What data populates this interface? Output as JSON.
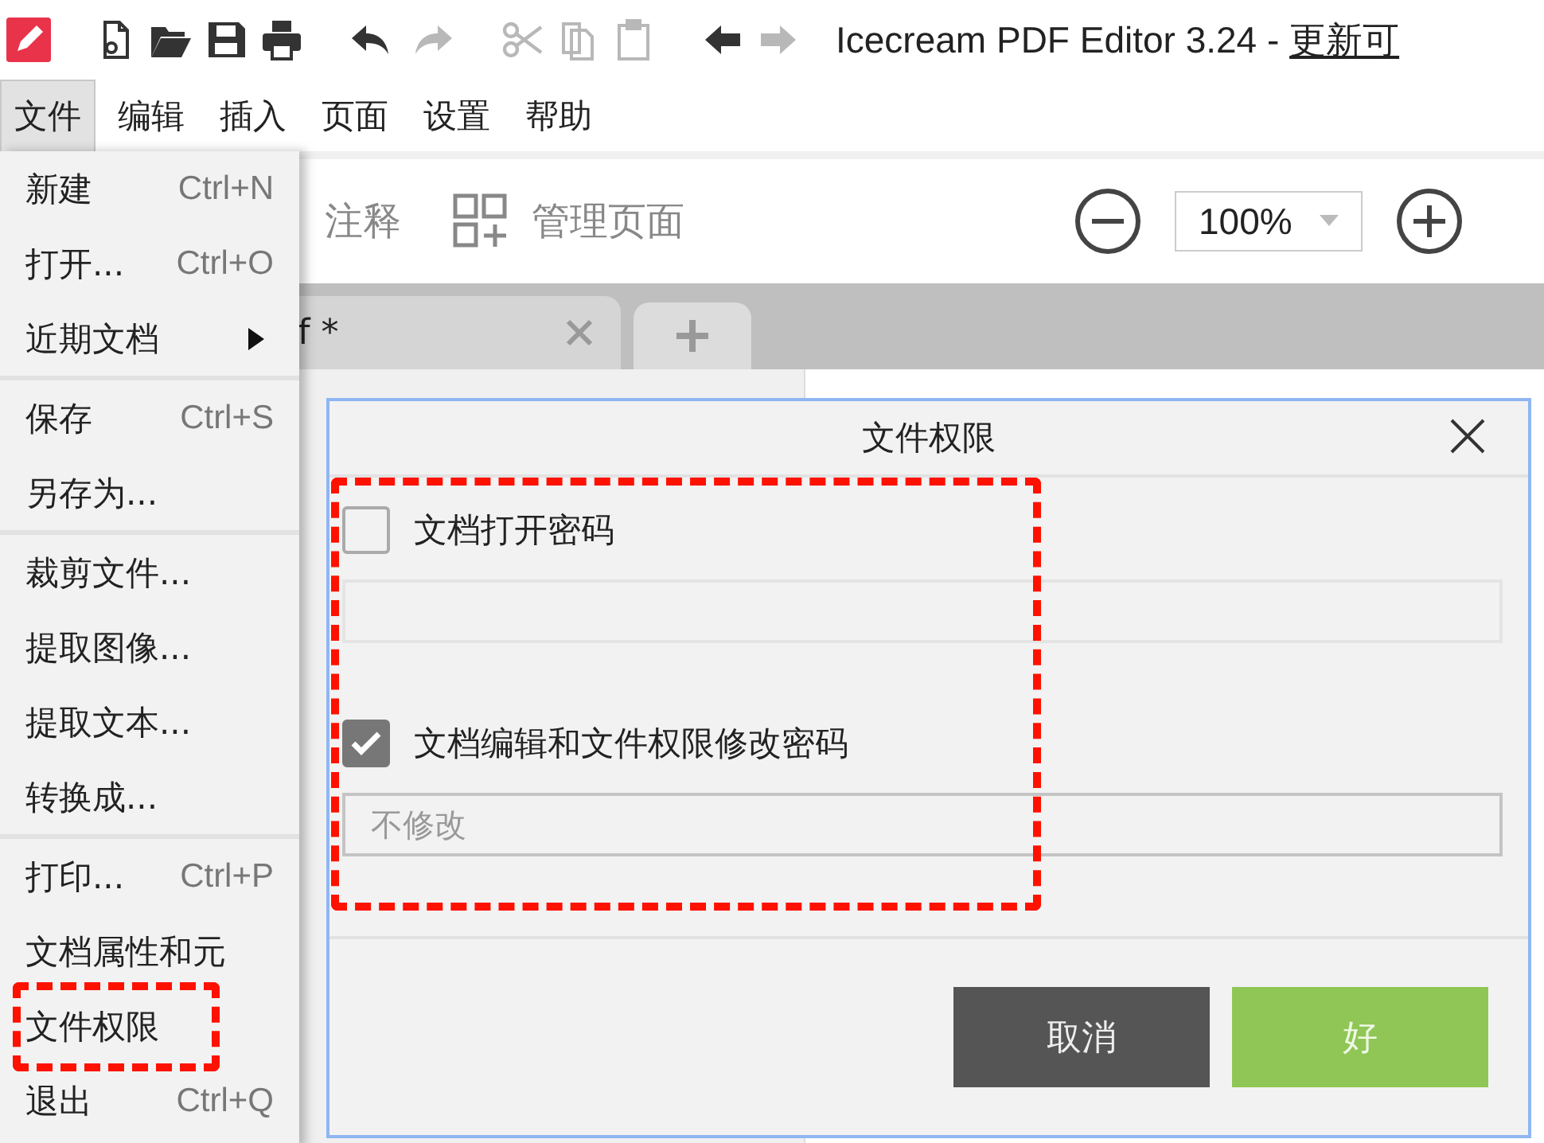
{
  "toolbar": [
    [
      {
        "kind": "new",
        "disabled": false
      },
      {
        "kind": "open",
        "disabled": false
      },
      {
        "kind": "save",
        "disabled": false
      },
      {
        "kind": "print",
        "disabled": false
      }
    ],
    [
      {
        "kind": "undo",
        "disabled": false
      },
      {
        "kind": "redo",
        "disabled": true
      }
    ],
    [
      {
        "kind": "cut",
        "disabled": true
      },
      {
        "kind": "copy",
        "disabled": true
      },
      {
        "kind": "paste",
        "disabled": true
      }
    ],
    [
      {
        "kind": "back",
        "disabled": false
      },
      {
        "kind": "forward",
        "disabled": true
      }
    ]
  ],
  "title": {
    "text": "Icecream PDF Editor 3.24 - ",
    "link": "更新可"
  },
  "menubar": [
    {
      "label": "文件",
      "selected": true
    },
    {
      "label": "编辑",
      "selected": false
    },
    {
      "label": "插入",
      "selected": false
    },
    {
      "label": "页面",
      "selected": false
    },
    {
      "label": "设置",
      "selected": false
    },
    {
      "label": "帮助",
      "selected": false
    }
  ],
  "ribbon": {
    "annotate": "注释",
    "manage_pages": "管理页面",
    "zoom": "100%"
  },
  "tabs": [
    {
      "label": "f *"
    }
  ],
  "file_menu": [
    [
      {
        "label": "新建",
        "shortcut": "Ctrl+N",
        "submenu": false,
        "annotated": false
      },
      {
        "label": "打开...",
        "shortcut": "Ctrl+O",
        "submenu": false,
        "annotated": false
      },
      {
        "label": "近期文档",
        "submenu": true,
        "annotated": false
      }
    ],
    [
      {
        "label": "保存",
        "shortcut": "Ctrl+S",
        "submenu": false,
        "annotated": false
      },
      {
        "label": "另存为...",
        "submenu": false,
        "annotated": false
      }
    ],
    [
      {
        "label": "裁剪文件...",
        "submenu": false,
        "annotated": false
      },
      {
        "label": "提取图像...",
        "submenu": false,
        "annotated": false
      },
      {
        "label": "提取文本...",
        "submenu": false,
        "annotated": false
      },
      {
        "label": "转换成...",
        "submenu": false,
        "annotated": false
      }
    ],
    [
      {
        "label": "打印...",
        "shortcut": "Ctrl+P",
        "submenu": false,
        "annotated": false
      },
      {
        "label": "文档属性和元",
        "submenu": false,
        "annotated": false
      },
      {
        "label": "文件权限",
        "submenu": false,
        "annotated": true
      },
      {
        "label": "退出",
        "shortcut": "Ctrl+Q",
        "submenu": false,
        "annotated": false
      }
    ]
  ],
  "dialog": {
    "title": "文件权限",
    "annotated": true,
    "options": [
      {
        "label": "文档打开密码",
        "checked": false
      },
      {
        "label": "文档编辑和文件权限修改密码",
        "checked": true,
        "placeholder": "不修改"
      }
    ],
    "buttons": [
      {
        "label": "取消",
        "kind": "secondary"
      },
      {
        "label": "好",
        "kind": "primary"
      }
    ]
  }
}
